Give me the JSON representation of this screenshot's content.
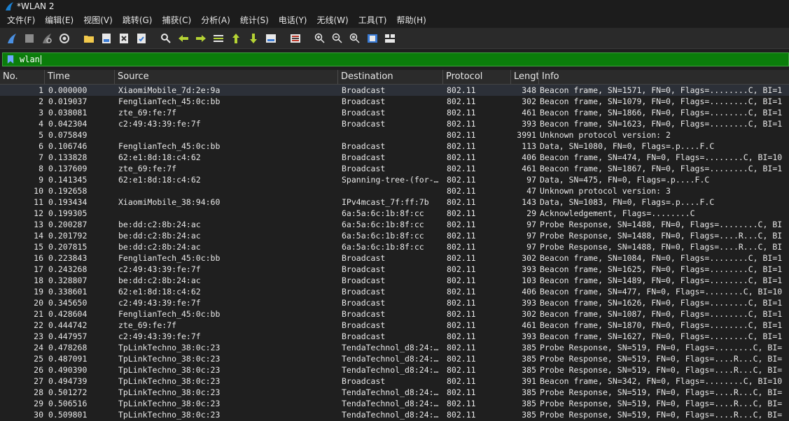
{
  "window": {
    "title": "*WLAN 2"
  },
  "menu": [
    "文件(F)",
    "编辑(E)",
    "视图(V)",
    "跳转(G)",
    "捕获(C)",
    "分析(A)",
    "统计(S)",
    "电话(Y)",
    "无线(W)",
    "工具(T)",
    "帮助(H)"
  ],
  "toolbar_icons": [
    "shark-fin-start-icon",
    "stop-square-icon",
    "restart-fin-icon",
    "gear-options-icon",
    "open-folder-icon",
    "save-file-icon",
    "close-file-icon",
    "reload-file-icon",
    "find-magnifier-icon",
    "go-back-arrow-icon",
    "go-forward-arrow-icon",
    "go-to-packet-icon",
    "go-first-arrow-icon",
    "go-last-arrow-icon",
    "auto-scroll-icon",
    "colorize-icon",
    "zoom-in-icon",
    "zoom-out-icon",
    "zoom-normal-icon",
    "resize-columns-icon",
    "layout-icon"
  ],
  "filter": {
    "value": "wlan"
  },
  "colors": {
    "filter_bg": "#0b7d0b",
    "bg": "#1f1f1f",
    "header_bg": "#2b2b2b"
  },
  "columns": [
    "No.",
    "Time",
    "Source",
    "Destination",
    "Protocol",
    "Lengt",
    "Info"
  ],
  "rows": [
    [
      "1",
      "0.000000",
      "XiaomiMobile_7d:2e:9a",
      "Broadcast",
      "802.11",
      "348",
      "Beacon frame, SN=1571, FN=0, Flags=........C, BI=1"
    ],
    [
      "2",
      "0.019037",
      "FenglianTech_45:0c:bb",
      "Broadcast",
      "802.11",
      "302",
      "Beacon frame, SN=1079, FN=0, Flags=........C, BI=1"
    ],
    [
      "3",
      "0.038081",
      "zte_69:fe:7f",
      "Broadcast",
      "802.11",
      "461",
      "Beacon frame, SN=1866, FN=0, Flags=........C, BI=1"
    ],
    [
      "4",
      "0.042304",
      "c2:49:43:39:fe:7f",
      "Broadcast",
      "802.11",
      "393",
      "Beacon frame, SN=1623, FN=0, Flags=........C, BI=1"
    ],
    [
      "5",
      "0.075849",
      "",
      "",
      "802.11",
      "3991",
      "Unknown protocol version: 2"
    ],
    [
      "6",
      "0.106746",
      "FenglianTech_45:0c:bb",
      "Broadcast",
      "802.11",
      "113",
      "Data, SN=1080, FN=0, Flags=.p....F.C"
    ],
    [
      "7",
      "0.133828",
      "62:e1:8d:18:c4:62",
      "Broadcast",
      "802.11",
      "406",
      "Beacon frame, SN=474, FN=0, Flags=........C, BI=10"
    ],
    [
      "8",
      "0.137609",
      "zte_69:fe:7f",
      "Broadcast",
      "802.11",
      "461",
      "Beacon frame, SN=1867, FN=0, Flags=........C, BI=1"
    ],
    [
      "9",
      "0.141345",
      "62:e1:8d:18:c4:62",
      "Spanning-tree-(for-…",
      "802.11",
      "97",
      "Data, SN=475, FN=0, Flags=.p....F.C"
    ],
    [
      "10",
      "0.192658",
      "",
      "",
      "802.11",
      "47",
      "Unknown protocol version: 3"
    ],
    [
      "11",
      "0.193434",
      "XiaomiMobile_38:94:60",
      "IPv4mcast_7f:ff:7b",
      "802.11",
      "143",
      "Data, SN=1083, FN=0, Flags=.p....F.C"
    ],
    [
      "12",
      "0.199305",
      "",
      "6a:5a:6c:1b:8f:cc",
      "802.11",
      "29",
      "Acknowledgement, Flags=........C"
    ],
    [
      "13",
      "0.200287",
      "be:dd:c2:8b:24:ac",
      "6a:5a:6c:1b:8f:cc",
      "802.11",
      "97",
      "Probe Response, SN=1488, FN=0, Flags=........C, BI"
    ],
    [
      "14",
      "0.201792",
      "be:dd:c2:8b:24:ac",
      "6a:5a:6c:1b:8f:cc",
      "802.11",
      "97",
      "Probe Response, SN=1488, FN=0, Flags=....R...C, BI"
    ],
    [
      "15",
      "0.207815",
      "be:dd:c2:8b:24:ac",
      "6a:5a:6c:1b:8f:cc",
      "802.11",
      "97",
      "Probe Response, SN=1488, FN=0, Flags=....R...C, BI"
    ],
    [
      "16",
      "0.223843",
      "FenglianTech_45:0c:bb",
      "Broadcast",
      "802.11",
      "302",
      "Beacon frame, SN=1084, FN=0, Flags=........C, BI=1"
    ],
    [
      "17",
      "0.243268",
      "c2:49:43:39:fe:7f",
      "Broadcast",
      "802.11",
      "393",
      "Beacon frame, SN=1625, FN=0, Flags=........C, BI=1"
    ],
    [
      "18",
      "0.328807",
      "be:dd:c2:8b:24:ac",
      "Broadcast",
      "802.11",
      "103",
      "Beacon frame, SN=1489, FN=0, Flags=........C, BI=1"
    ],
    [
      "19",
      "0.338601",
      "62:e1:8d:18:c4:62",
      "Broadcast",
      "802.11",
      "406",
      "Beacon frame, SN=477, FN=0, Flags=........C, BI=10"
    ],
    [
      "20",
      "0.345650",
      "c2:49:43:39:fe:7f",
      "Broadcast",
      "802.11",
      "393",
      "Beacon frame, SN=1626, FN=0, Flags=........C, BI=1"
    ],
    [
      "21",
      "0.428604",
      "FenglianTech_45:0c:bb",
      "Broadcast",
      "802.11",
      "302",
      "Beacon frame, SN=1087, FN=0, Flags=........C, BI=1"
    ],
    [
      "22",
      "0.444742",
      "zte_69:fe:7f",
      "Broadcast",
      "802.11",
      "461",
      "Beacon frame, SN=1870, FN=0, Flags=........C, BI=1"
    ],
    [
      "23",
      "0.447957",
      "c2:49:43:39:fe:7f",
      "Broadcast",
      "802.11",
      "393",
      "Beacon frame, SN=1627, FN=0, Flags=........C, BI=1"
    ],
    [
      "24",
      "0.478268",
      "TpLinkTechno_38:0c:23",
      "TendaTechnol_d8:24:…",
      "802.11",
      "385",
      "Probe Response, SN=519, FN=0, Flags=........C, BI="
    ],
    [
      "25",
      "0.487091",
      "TpLinkTechno_38:0c:23",
      "TendaTechnol_d8:24:…",
      "802.11",
      "385",
      "Probe Response, SN=519, FN=0, Flags=....R...C, BI="
    ],
    [
      "26",
      "0.490390",
      "TpLinkTechno_38:0c:23",
      "TendaTechnol_d8:24:…",
      "802.11",
      "385",
      "Probe Response, SN=519, FN=0, Flags=....R...C, BI="
    ],
    [
      "27",
      "0.494739",
      "TpLinkTechno_38:0c:23",
      "Broadcast",
      "802.11",
      "391",
      "Beacon frame, SN=342, FN=0, Flags=........C, BI=10"
    ],
    [
      "28",
      "0.501272",
      "TpLinkTechno_38:0c:23",
      "TendaTechnol_d8:24:…",
      "802.11",
      "385",
      "Probe Response, SN=519, FN=0, Flags=....R...C, BI="
    ],
    [
      "29",
      "0.506516",
      "TpLinkTechno_38:0c:23",
      "TendaTechnol_d8:24:…",
      "802.11",
      "385",
      "Probe Response, SN=519, FN=0, Flags=....R...C, BI="
    ],
    [
      "30",
      "0.509801",
      "TpLinkTechno_38:0c:23",
      "TendaTechnol_d8:24:…",
      "802.11",
      "385",
      "Probe Response, SN=519, FN=0, Flags=....R...C, BI="
    ]
  ]
}
